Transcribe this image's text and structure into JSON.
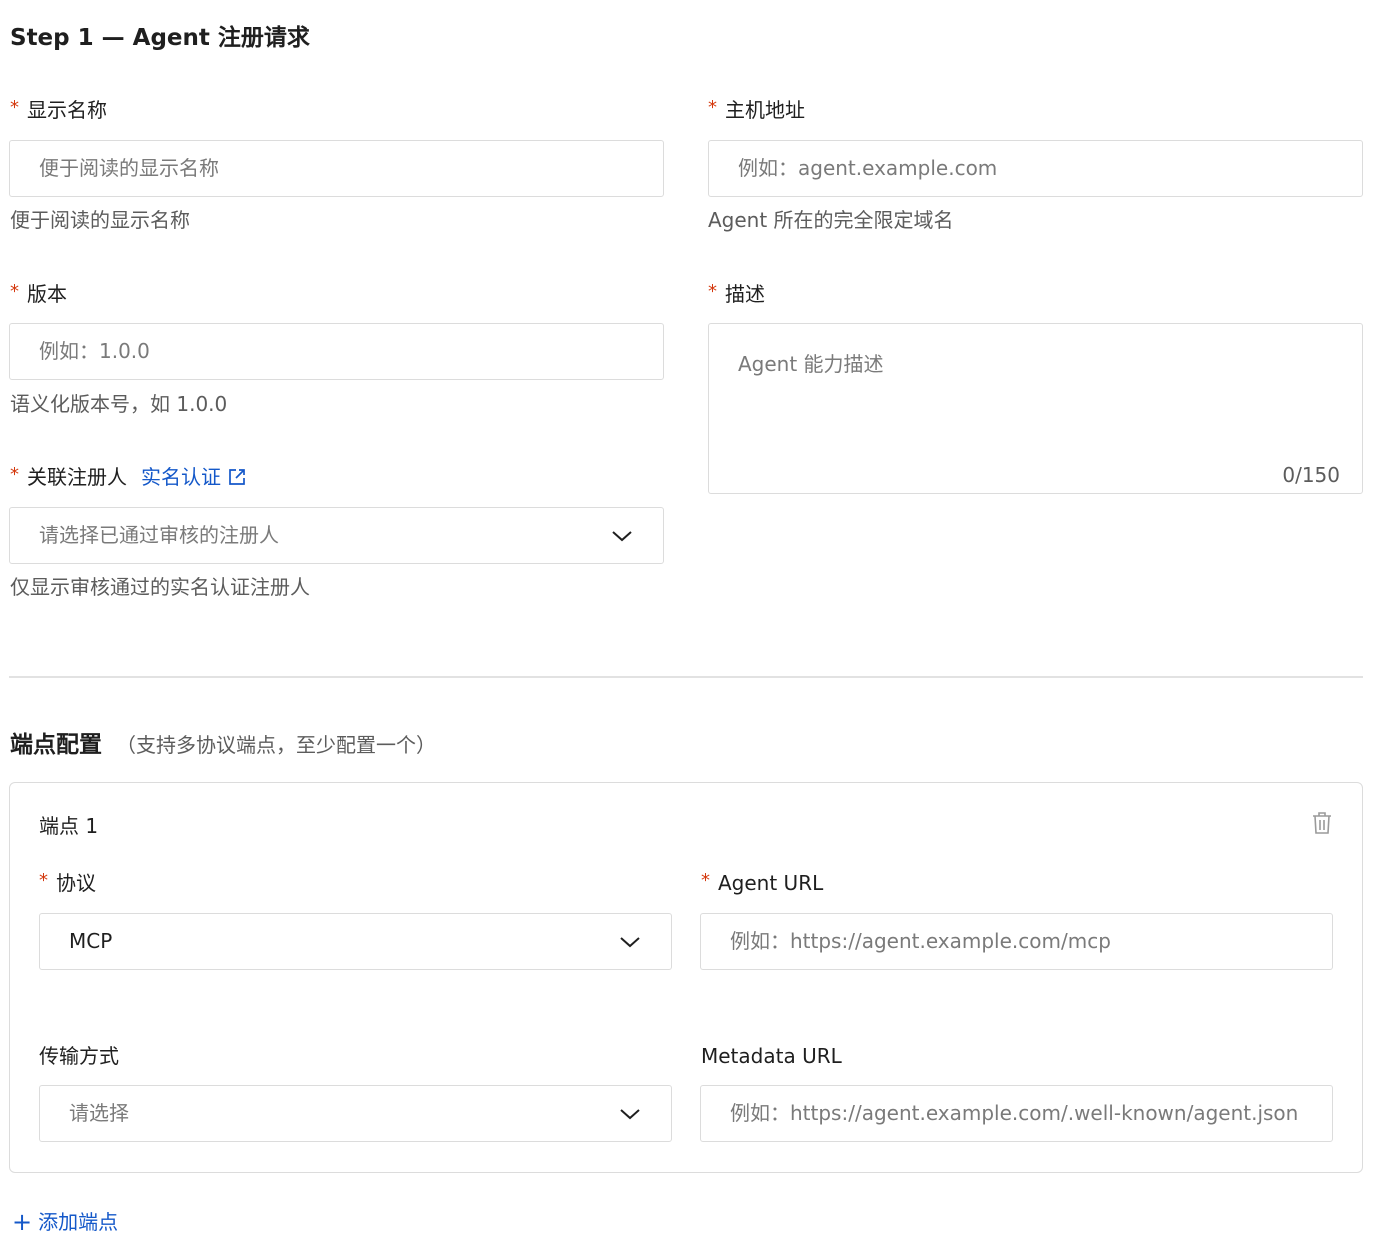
{
  "step": {
    "title": "Step 1 — Agent 注册请求"
  },
  "colors": {
    "required": "#d4380d",
    "link": "#1458c9",
    "border": "#dcdcdc"
  },
  "form": {
    "display_name": {
      "label": "显示名称",
      "placeholder": "便于阅读的显示名称",
      "help": "便于阅读的显示名称"
    },
    "host": {
      "label": "主机地址",
      "placeholder": "例如：agent.example.com",
      "help": "Agent 所在的完全限定域名"
    },
    "version": {
      "label": "版本",
      "placeholder": "例如：1.0.0",
      "help": "语义化版本号，如 1.0.0"
    },
    "description": {
      "label": "描述",
      "placeholder": "Agent 能力描述",
      "counter": "0/150"
    },
    "registrant": {
      "label": "关联注册人",
      "link": "实名认证",
      "link_icon": "external-link-icon",
      "placeholder": "请选择已通过审核的注册人",
      "help": "仅显示审核通过的实名认证注册人"
    }
  },
  "endpoints": {
    "title": "端点配置",
    "note": "（支持多协议端点，至少配置一个）",
    "items": [
      {
        "title": "端点 1",
        "delete_icon": "trash-icon",
        "protocol": {
          "label": "协议",
          "value": "MCP"
        },
        "agent_url": {
          "label": "Agent URL",
          "placeholder": "例如：https://agent.example.com/mcp"
        },
        "transport": {
          "label": "传输方式",
          "placeholder": "请选择"
        },
        "metadata_url": {
          "label": "Metadata URL",
          "placeholder": "例如：https://agent.example.com/.well-known/agent.json"
        }
      }
    ],
    "add_label": "添加端点"
  },
  "required_mark": "*"
}
